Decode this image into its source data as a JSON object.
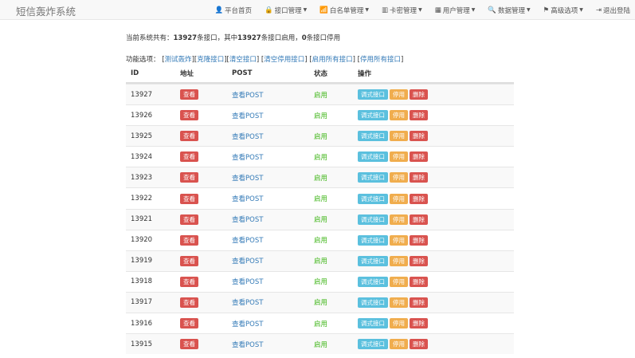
{
  "navbar": {
    "brand": "短信轰炸系统",
    "items": [
      {
        "icon": "user-icon",
        "glyph": "👤",
        "label": "平台首页",
        "caret": false
      },
      {
        "icon": "lock-icon",
        "glyph": "🔒",
        "label": "接口管理",
        "caret": true
      },
      {
        "icon": "bar-chart-icon",
        "glyph": "📶",
        "label": "白名单管理",
        "caret": true
      },
      {
        "icon": "barcode-icon",
        "glyph": "▥",
        "label": "卡密管理",
        "caret": true
      },
      {
        "icon": "grid-icon",
        "glyph": "▦",
        "label": "用户管理",
        "caret": true
      },
      {
        "icon": "search-icon",
        "glyph": "🔍",
        "label": "数据管理",
        "caret": true
      },
      {
        "icon": "flag-icon",
        "glyph": "⚑",
        "label": "高级选项",
        "caret": true
      },
      {
        "icon": "logout-icon",
        "glyph": "⇥",
        "label": "退出登陆",
        "caret": false
      }
    ]
  },
  "summary": {
    "prefix": "当前系统共有：",
    "total": "13927",
    "mid1": "条接口，其中",
    "enabled": "13927",
    "mid2": "条接口启用，",
    "disabled": "0",
    "suffix": "条接口停用"
  },
  "functions": {
    "label": "功能选项：",
    "links": [
      "测试轰炸",
      "克隆接口",
      "清空接口",
      "清空停用接口",
      "启用所有接口",
      "停用所有接口"
    ]
  },
  "table": {
    "headers": [
      "ID",
      "地址",
      "POST",
      "状态",
      "操作"
    ],
    "view_label": "查看",
    "post_label": "查看POST",
    "status_label": "启用",
    "op_debug": "调式接口",
    "op_disable": "停用",
    "op_delete": "删除",
    "rows": [
      "13927",
      "13926",
      "13925",
      "13924",
      "13923",
      "13922",
      "13921",
      "13920",
      "13919",
      "13918",
      "13917",
      "13916",
      "13915"
    ]
  },
  "colors": {
    "danger": "#d9534f",
    "info": "#5bc0de",
    "warning": "#f0ad4e",
    "success": "#3fb618",
    "link": "#337ab7"
  }
}
